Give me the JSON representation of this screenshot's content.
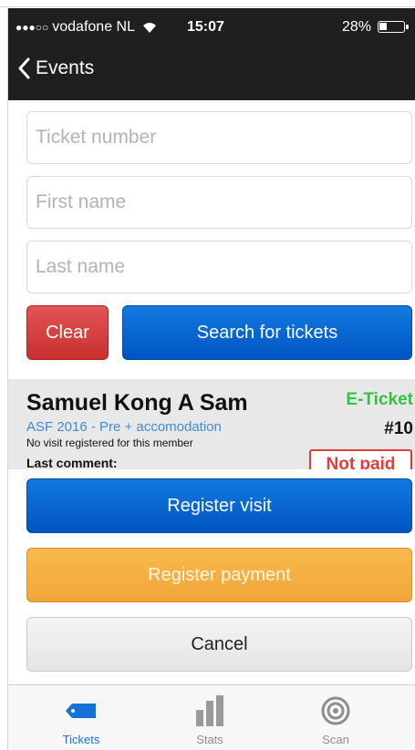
{
  "status": {
    "carrier": "vodafone NL",
    "time": "15:07",
    "battery": "28%",
    "signal_dots": "●●●○○"
  },
  "nav": {
    "back_label": "Events"
  },
  "form": {
    "ticket_placeholder": "Ticket number",
    "first_name_placeholder": "First name",
    "last_name_placeholder": "Last name",
    "clear_label": "Clear",
    "search_label": "Search for tickets"
  },
  "result": {
    "name": "Samuel Kong A Sam",
    "ticket_type": "E-Ticket",
    "event": "ASF 2016 - Pre + accomodation",
    "ticket_number": "#10",
    "visit_note": "No visit registered for this member",
    "comment_label": "Last comment:",
    "payment_status": "Not paid"
  },
  "actions": {
    "register_visit": "Register visit",
    "register_payment": "Register payment",
    "cancel": "Cancel"
  },
  "tabs": [
    {
      "label": "Tickets",
      "icon": "ticket-icon",
      "active": true
    },
    {
      "label": "Stats",
      "icon": "bar-chart-icon",
      "active": false
    },
    {
      "label": "Scan",
      "icon": "target-icon",
      "active": false
    }
  ],
  "colors": {
    "accent_blue": "#1672d8",
    "danger_red": "#d33c3b",
    "warning_orange": "#f4ae42",
    "success_green": "#35c23f"
  }
}
